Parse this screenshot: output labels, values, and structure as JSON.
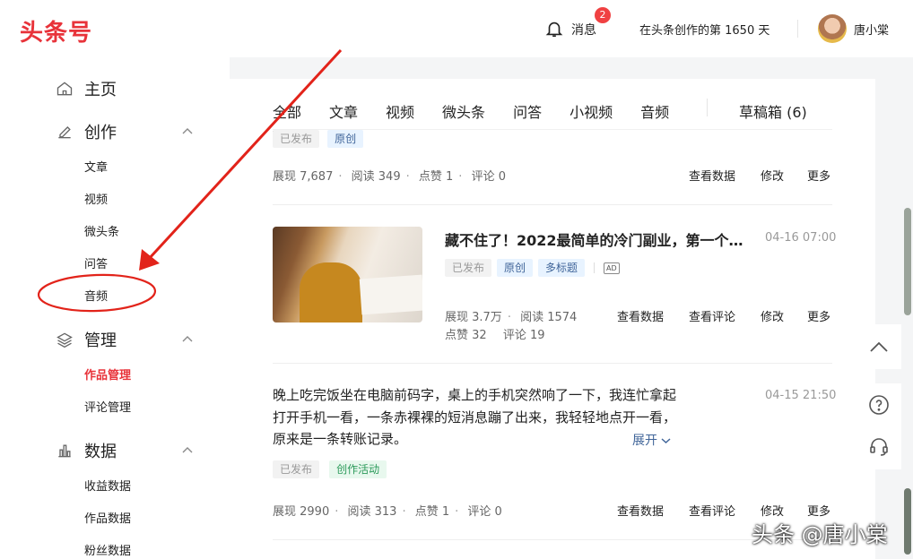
{
  "header": {
    "logo": "头条号",
    "messages_label": "消息",
    "messages_badge": "2",
    "days_text": "在头条创作的第 1650 天",
    "username": "唐小棠"
  },
  "sidebar": {
    "home": "主页",
    "create": {
      "label": "创作",
      "items": [
        "文章",
        "视频",
        "微头条",
        "问答",
        "音频"
      ]
    },
    "manage": {
      "label": "管理",
      "items": [
        "作品管理",
        "评论管理"
      ]
    },
    "data": {
      "label": "数据",
      "items": [
        "收益数据",
        "作品数据",
        "粉丝数据"
      ]
    }
  },
  "tabs": [
    "全部",
    "文章",
    "视频",
    "微头条",
    "问答",
    "小视频",
    "音频"
  ],
  "drafts_label": "草稿箱 (6)",
  "items": [
    {
      "tags": [
        "已发布",
        "原创"
      ],
      "stats": [
        "展现 7,687",
        "阅读 349",
        "点赞 1",
        "评论 0"
      ],
      "actions": [
        "查看数据",
        "修改",
        "更多"
      ]
    },
    {
      "title": "藏不住了！2022最简单的冷门副业，第一个我…",
      "date": "04-16 07:00",
      "tags": [
        "已发布",
        "原创",
        "多标题"
      ],
      "ad_label": "AD",
      "stats_line1": [
        "展现 3.7万",
        "阅读 1574"
      ],
      "stats_line2": [
        "点赞 32",
        "评论 19"
      ],
      "actions": [
        "查看数据",
        "查看评论",
        "修改",
        "更多"
      ]
    },
    {
      "text": "晚上吃完饭坐在电脑前码字，桌上的手机突然响了一下，我连忙拿起打开手机一看，一条赤裸裸的短消息蹦了出来，我轻轻地点开一看，原来是一条转账记录。",
      "expand_label": "展开",
      "date": "04-15 21:50",
      "tags": [
        "已发布",
        "创作活动"
      ],
      "stats": [
        "展现 2990",
        "阅读 313",
        "点赞 1",
        "评论 0"
      ],
      "actions": [
        "查看数据",
        "查看评论",
        "修改",
        "更多"
      ]
    }
  ],
  "watermark": "头条 @唐小棠",
  "colors": {
    "brand_red": "#e8333a",
    "annotation_red": "#e2231a",
    "link_blue": "#406599"
  }
}
